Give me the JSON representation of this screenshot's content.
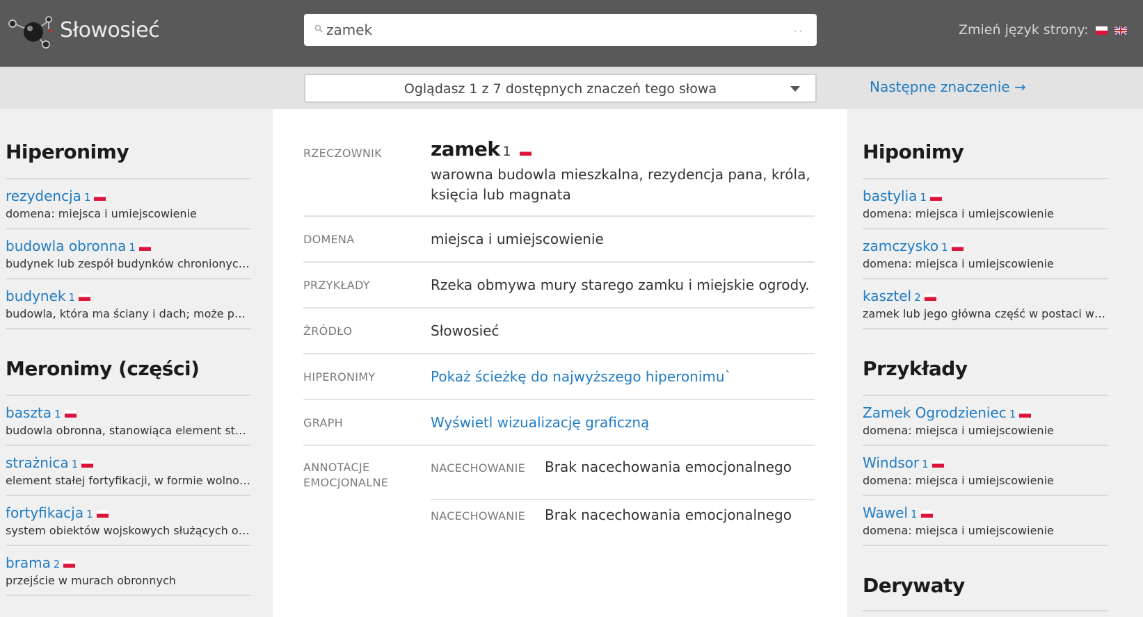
{
  "header": {
    "brand": "Słowosieć",
    "search_value": "zamek",
    "lang_label": "Zmień język strony:"
  },
  "sensebar": {
    "select_text": "Oglądasz 1 z 7 dostępnych znaczeń tego słowa",
    "next_link": "Następne znaczenie →"
  },
  "left": {
    "hyperonyms_title": "Hiperonimy",
    "hyperonyms": [
      {
        "word": "rezydencja",
        "num": "1",
        "desc": "domena: miejsca i umiejscowienie"
      },
      {
        "word": "budowla obronna",
        "num": "1",
        "desc": "budynek lub zespół budynków chronionych przed atakiem"
      },
      {
        "word": "budynek",
        "num": "1",
        "desc": "budowla, która ma ściany i dach; może pełnić różne funkcje"
      }
    ],
    "meronyms_title": "Meronimy (części)",
    "meronyms": [
      {
        "word": "baszta",
        "num": "1",
        "desc": "budowla obronna, stanowiąca element starych fortyfikacji"
      },
      {
        "word": "strażnica",
        "num": "1",
        "desc": "element stałej fortyfikacji, w formie wolnostojącej budowli"
      },
      {
        "word": "fortyfikacja",
        "num": "1",
        "desc": "system obiektów wojskowych służących obronie terenu"
      },
      {
        "word": "brama",
        "num": "2",
        "desc": "przejście w murach obronnych"
      }
    ]
  },
  "main": {
    "pos_label": "RZECZOWNIK",
    "headword": "zamek",
    "headword_num": "1",
    "definition_line1": "warowna budowla mieszkalna, rezydencja pana, króla,",
    "definition_line2": "księcia lub magnata",
    "domain_label": "DOMENA",
    "domain_value": "miejsca i umiejscowienie",
    "examples_label": "PRZYKŁADY",
    "examples_value": "Rzeka obmywa mury starego zamku i miejskie ogrody.",
    "source_label": "ŹRÓDŁO",
    "source_value": "Słowosieć",
    "hyper_label": "HIPERONIMY",
    "hyper_link": "Pokaż ścieżkę do najwyższego hiperonimu`",
    "graph_label": "GRAPH",
    "graph_link": "Wyświetl wizualizację graficzną",
    "annot_label_1": "ANNOTACJE",
    "annot_label_2": "EMOCJONALNE",
    "annotations": [
      {
        "label": "NACECHOWANIE",
        "value": "Brak nacechowania emocjonalnego"
      },
      {
        "label": "NACECHOWANIE",
        "value": "Brak nacechowania emocjonalnego"
      }
    ]
  },
  "right": {
    "hyponyms_title": "Hiponimy",
    "hyponyms": [
      {
        "word": "bastylia",
        "num": "1",
        "desc": "domena: miejsca i umiejscowienie"
      },
      {
        "word": "zamczysko",
        "num": "1",
        "desc": "domena: miejsca i umiejscowienie"
      },
      {
        "word": "kasztel",
        "num": "2",
        "desc": "zamek lub jego główna część w postaci warownej wieży"
      }
    ],
    "examples_title": "Przykłady",
    "examples": [
      {
        "word": "Zamek Ogrodzieniec",
        "num": "1",
        "desc": "domena: miejsca i umiejscowienie"
      },
      {
        "word": "Windsor",
        "num": "1",
        "desc": "domena: miejsca i umiejscowienie"
      },
      {
        "word": "Wawel",
        "num": "1",
        "desc": "domena: miejsca i umiejscowienie"
      }
    ],
    "derivatives_title": "Derywaty"
  },
  "colors": {
    "topbar": "#595959",
    "link": "#1f7bc4",
    "flag_red": "#dc143c"
  }
}
